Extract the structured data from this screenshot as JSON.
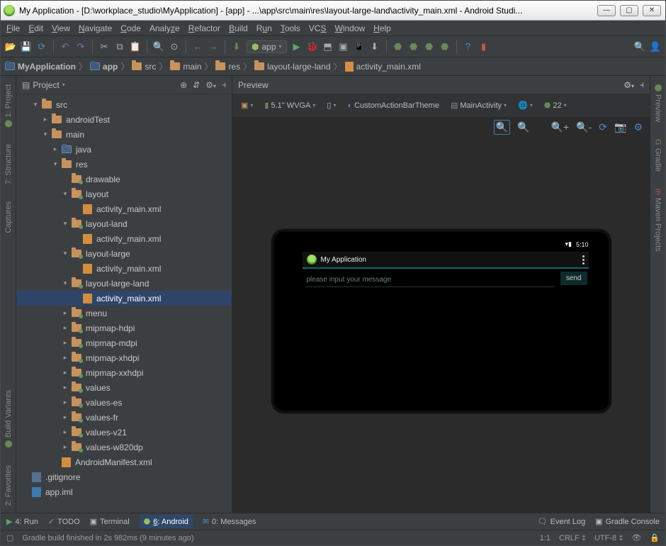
{
  "title": "My Application - [D:\\workplace_studio\\MyApplication] - [app] - ...\\app\\src\\main\\res\\layout-large-land\\activity_main.xml - Android Studi...",
  "menu": [
    "File",
    "Edit",
    "View",
    "Navigate",
    "Code",
    "Analyze",
    "Refactor",
    "Build",
    "Run",
    "Tools",
    "VCS",
    "Window",
    "Help"
  ],
  "runconfig": "app",
  "breadcrumbs": [
    "MyApplication",
    "app",
    "src",
    "main",
    "res",
    "layout-large-land",
    "activity_main.xml"
  ],
  "project": {
    "label": "Project"
  },
  "tree": {
    "src": "src",
    "androidTest": "androidTest",
    "main": "main",
    "java": "java",
    "res": "res",
    "drawable": "drawable",
    "layout": "layout",
    "layout_land": "layout-land",
    "layout_large": "layout-large",
    "layout_large_land": "layout-large-land",
    "activity_main": "activity_main.xml",
    "menu": "menu",
    "mipmap_hdpi": "mipmap-hdpi",
    "mipmap_mdpi": "mipmap-mdpi",
    "mipmap_xhdpi": "mipmap-xhdpi",
    "mipmap_xxhdpi": "mipmap-xxhdpi",
    "values": "values",
    "values_es": "values-es",
    "values_fr": "values-fr",
    "values_v21": "values-v21",
    "values_w820dp": "values-w820dp",
    "manifest": "AndroidManifest.xml",
    "gitignore": ".gitignore",
    "appiml": "app.iml"
  },
  "left_tabs": [
    "1: Project",
    "7: Structure",
    "Captures",
    "Build Variants",
    "2: Favorites"
  ],
  "right_tabs": [
    "Preview",
    "Gradle",
    "Maven Projects"
  ],
  "preview": {
    "label": "Preview",
    "device": "5.1\" WVGA",
    "theme": "CustomActionBarTheme",
    "activity": "MainActivity",
    "api": "22",
    "app_title": "My Application",
    "time": "5:10",
    "placeholder": "please input your message",
    "send": "send"
  },
  "bottom": {
    "run": "4: Run",
    "todo": "TODO",
    "terminal": "Terminal",
    "android": "6: Android",
    "messages": "0: Messages",
    "eventlog": "Event Log",
    "gradle": "Gradle Console"
  },
  "status": {
    "msg": "Gradle build finished in 2s 982ms (9 minutes ago)",
    "pos": "1:1",
    "eol": "CRLF",
    "enc": "UTF-8"
  }
}
